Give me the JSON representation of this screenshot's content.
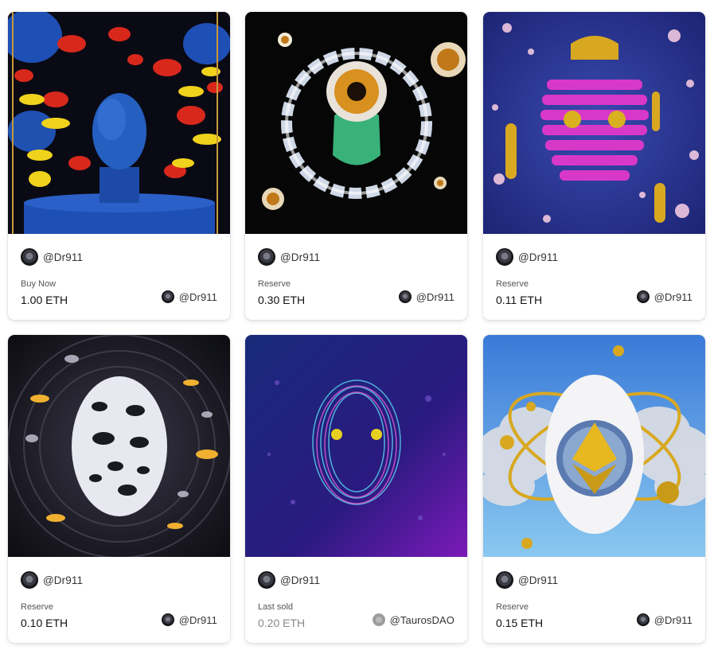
{
  "cards": [
    {
      "creator": "@Dr911",
      "price_label": "Buy Now",
      "price": "1.00 ETH",
      "owner": "@Dr911",
      "art": "blue-head-with-red-yellow-blobs"
    },
    {
      "creator": "@Dr911",
      "price_label": "Reserve",
      "price": "0.30 ETH",
      "owner": "@Dr911",
      "art": "eye-head-with-bubble-ring"
    },
    {
      "creator": "@Dr911",
      "price_label": "Reserve",
      "price": "0.11 ETH",
      "owner": "@Dr911",
      "art": "pink-striped-head"
    },
    {
      "creator": "@Dr911",
      "price_label": "Reserve",
      "price": "0.10 ETH",
      "owner": "@Dr911",
      "art": "chrome-spotted-head"
    },
    {
      "creator": "@Dr911",
      "price_label": "Last sold",
      "price": "0.20 ETH",
      "owner": "@TaurosDAO",
      "art": "neon-wireframe-head"
    },
    {
      "creator": "@Dr911",
      "price_label": "Reserve",
      "price": "0.15 ETH",
      "owner": "@Dr911",
      "art": "white-head-eth-logo-clouds"
    }
  ],
  "colors": {
    "price_text": "#111111",
    "muted_price_text": "#888888",
    "label_text": "#555555"
  }
}
